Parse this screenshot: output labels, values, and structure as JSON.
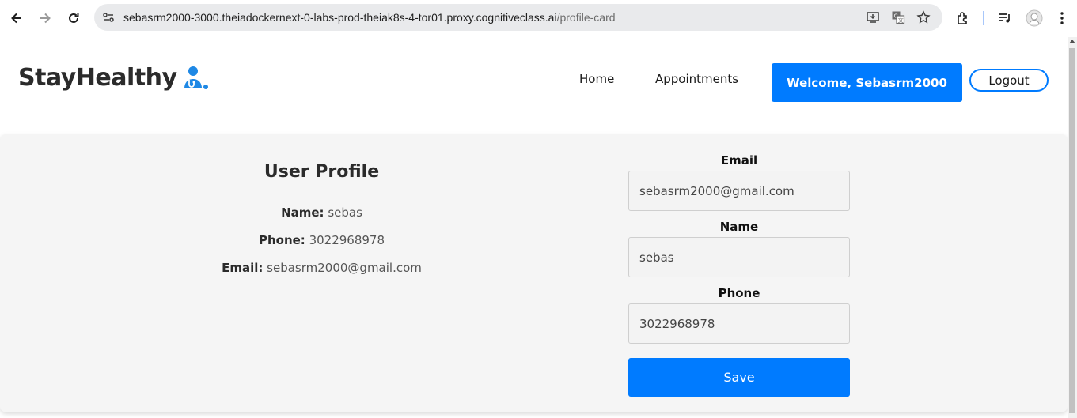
{
  "browser": {
    "url_host": "sebasrm2000-3000.theiadockernext-0-labs-prod-theiak8s-4-tor01.proxy.cognitiveclass.ai",
    "url_path": "/profile-card",
    "icons": [
      "back-icon",
      "forward-icon",
      "reload-icon",
      "site-info-icon",
      "install-app-icon",
      "translate-icon",
      "bookmark-star-icon",
      "extensions-icon",
      "media-control-icon",
      "profile-avatar-icon",
      "more-menu-icon"
    ]
  },
  "header": {
    "brand": "StayHealthy",
    "nav": {
      "home": "Home",
      "appointments": "Appointments"
    },
    "welcome": "Welcome, Sebasrm2000",
    "logout": "Logout"
  },
  "profile": {
    "title": "User Profile",
    "name_label": "Name:",
    "name_value": "sebas",
    "phone_label": "Phone:",
    "phone_value": "3022968978",
    "email_label": "Email:",
    "email_value": "sebasrm2000@gmail.com"
  },
  "form": {
    "email_label": "Email",
    "email_value": "sebasrm2000@gmail.com",
    "name_label": "Name",
    "name_value": "sebas",
    "phone_label": "Phone",
    "phone_value": "3022968978",
    "save": "Save"
  },
  "colors": {
    "accent": "#007bff",
    "card_bg": "#f5f5f5",
    "text_dark": "#2b2b2b"
  }
}
